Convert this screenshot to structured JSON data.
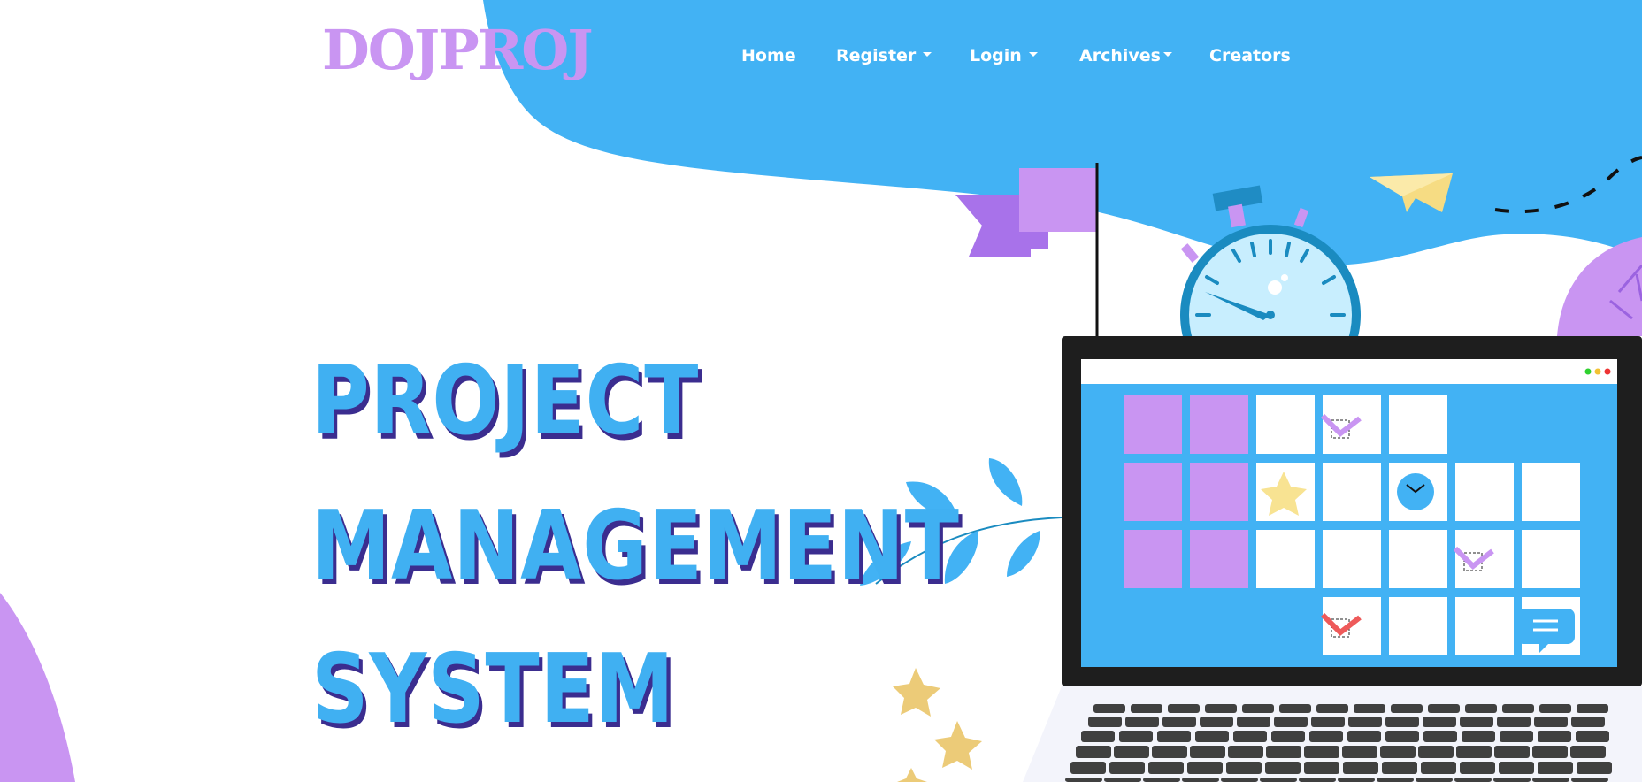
{
  "brand": {
    "name": "DOJPROJ"
  },
  "nav": {
    "items": [
      {
        "label": "Home",
        "dropdown": false
      },
      {
        "label": "Register",
        "dropdown": true
      },
      {
        "label": "Login",
        "dropdown": true
      },
      {
        "label": "Archives",
        "dropdown": true
      },
      {
        "label": "Creators",
        "dropdown": false
      }
    ]
  },
  "hero": {
    "lines": [
      "PROJECT",
      "MANAGEMENT",
      "SYSTEM"
    ]
  },
  "colors": {
    "primary_blue": "#40b0f2",
    "accent_purple": "#c995f2",
    "title_shadow": "#3b2d8f",
    "laptop_frame": "#1e1e1e"
  },
  "illustration": {
    "icons": [
      "flag-icon",
      "stopwatch-icon",
      "paper-plane-icon",
      "laptop-icon",
      "calendar-grid-icon",
      "star-icon",
      "check-icon",
      "clock-icon",
      "chat-icon",
      "leaf-branch-icon",
      "keyboard-icon"
    ]
  }
}
